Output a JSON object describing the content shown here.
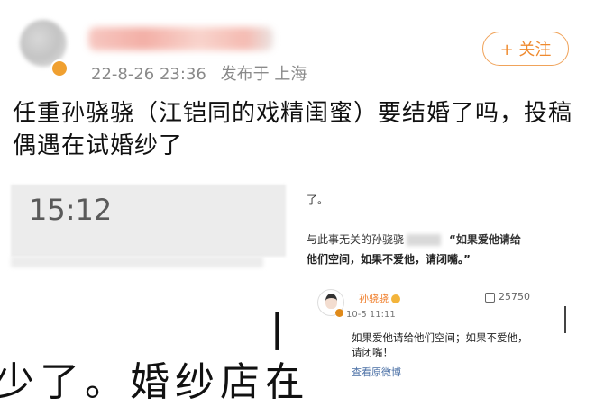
{
  "post": {
    "username_blurred": "",
    "date": "22-8-26 23:36",
    "location": "发布于 上海",
    "follow_label": "+ 关注",
    "content_line1": "任重孙骁骁（江铠同的戏精闺蜜）要结婚了吗，投稿",
    "content_line2": "偶遇在试婚纱了"
  },
  "left_shot": {
    "time": "15:12",
    "bar_fragment": "|",
    "bottom_text": "少了。婚纱店在"
  },
  "right_shot": {
    "line1": "了。",
    "line2_prefix": "与此事无关的孙骁骁",
    "quote_a": "“如果爱他请给",
    "quote_b": "他们空间，如果不爱他，请闭嘴。”",
    "commenter": "孙骁骁",
    "likes": "25750",
    "date": "10-5 11:11",
    "comment_text": "如果爱他请给他们空间；如果不爱他，请闭嘴！",
    "view_original": "查看原微博"
  },
  "colors": {
    "accent_orange": "#ef8a2f",
    "link_blue": "#4a6fa5"
  }
}
